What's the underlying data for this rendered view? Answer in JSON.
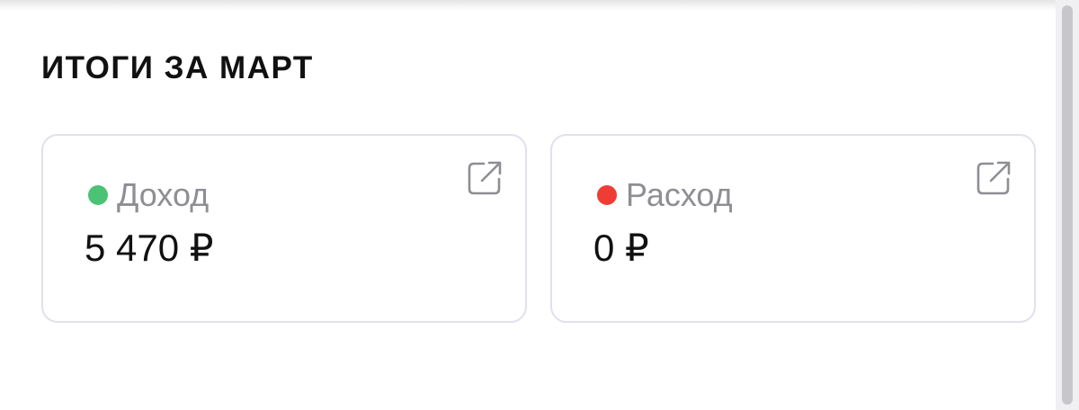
{
  "section": {
    "title": "ИТОГИ ЗА МАРТ"
  },
  "cards": {
    "income": {
      "label": "Доход",
      "value": "5 470 ₽",
      "dot_color": "#4cc274",
      "icon": "external-link-icon"
    },
    "expense": {
      "label": "Расход",
      "value": "0 ₽",
      "dot_color": "#ef3d35",
      "icon": "external-link-icon"
    }
  }
}
